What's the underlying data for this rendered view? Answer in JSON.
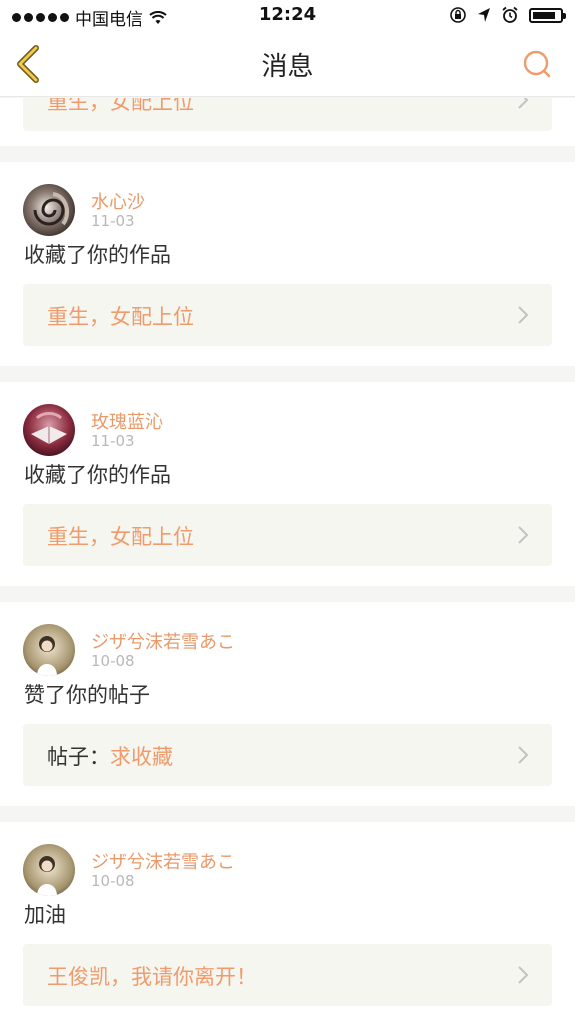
{
  "status_bar": {
    "carrier": "中国电信",
    "time": "12:24",
    "battery_level": 0.85
  },
  "nav": {
    "title": "消息",
    "back_icon": "back-chevron-icon",
    "search_icon": "search-icon"
  },
  "top_partial": {
    "ref_text": "重生，女配上位"
  },
  "notifications": [
    {
      "username": "水心沙",
      "date": "11-03",
      "message": "收藏了你的作品",
      "ref_prefix": "",
      "ref_text": "重生，女配上位"
    },
    {
      "username": "玫瑰蓝沁",
      "date": "11-03",
      "message": "收藏了你的作品",
      "ref_prefix": "",
      "ref_text": "重生，女配上位"
    },
    {
      "username": "ジザ兮沫若雪あこ",
      "date": "10-08",
      "message": "赞了你的帖子",
      "ref_prefix": "帖子：",
      "ref_text": "求收藏"
    },
    {
      "username": "ジザ兮沫若雪あこ",
      "date": "10-08",
      "message": "加油",
      "ref_prefix": "",
      "ref_text": "王俊凯，我请你离开！"
    }
  ],
  "colors": {
    "accent": "#ef9b6b",
    "ref_bg": "#f6f6f0",
    "separator": "#f5f5f3"
  }
}
